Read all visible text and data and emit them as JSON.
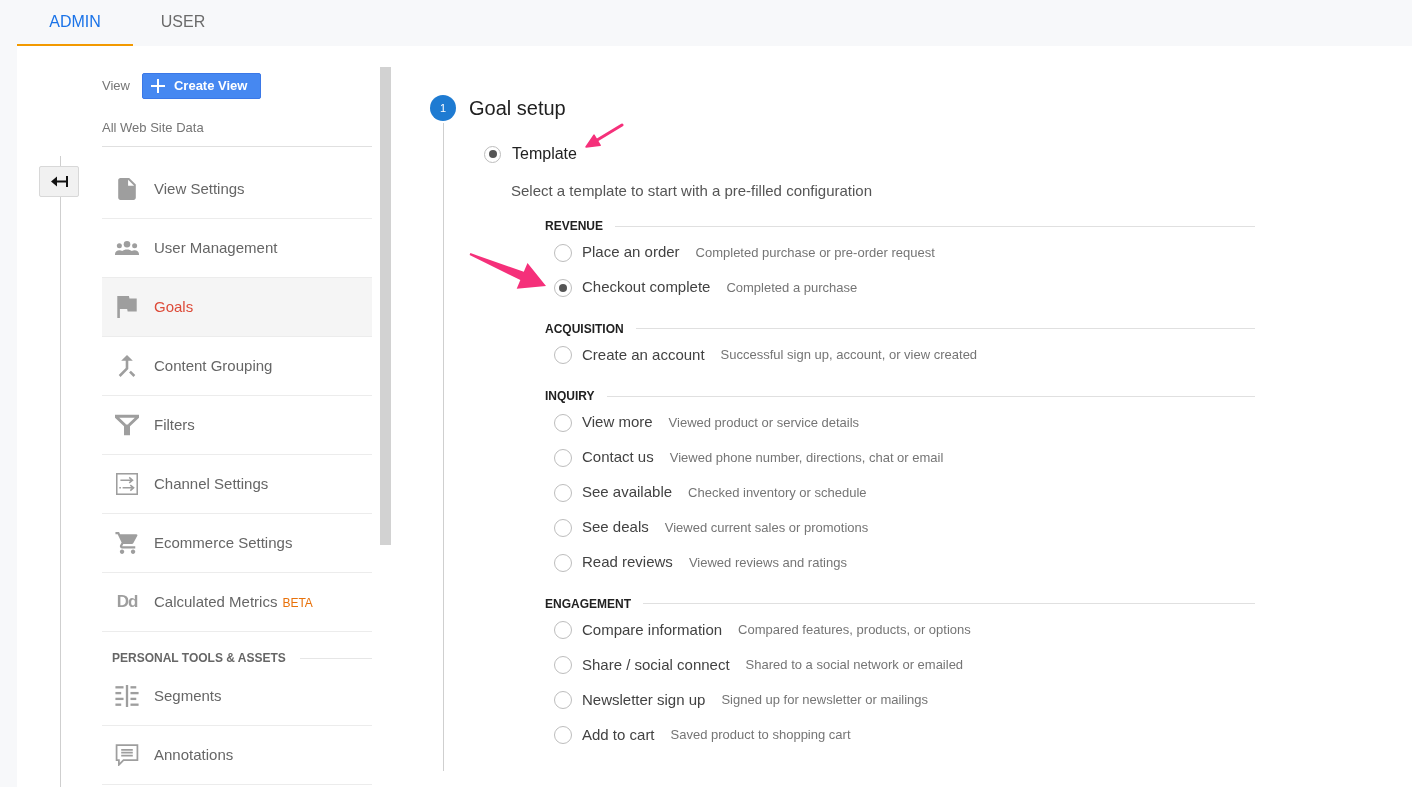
{
  "tabs": [
    {
      "label": "ADMIN",
      "selected": true
    },
    {
      "label": "USER",
      "selected": false
    }
  ],
  "sidebar": {
    "view_label": "View",
    "create_button": "Create View",
    "view_name": "All Web Site Data",
    "items": [
      {
        "label": "View Settings",
        "selected": false
      },
      {
        "label": "User Management",
        "selected": false
      },
      {
        "label": "Goals",
        "selected": true
      },
      {
        "label": "Content Grouping",
        "selected": false
      },
      {
        "label": "Filters",
        "selected": false
      },
      {
        "label": "Channel Settings",
        "selected": false
      },
      {
        "label": "Ecommerce Settings",
        "selected": false
      },
      {
        "label": "Calculated Metrics",
        "selected": false,
        "icon_text": "Dd",
        "badge": "BETA"
      }
    ],
    "personal_section": {
      "title": "PERSONAL TOOLS & ASSETS",
      "items": [
        {
          "label": "Segments",
          "selected": false
        },
        {
          "label": "Annotations",
          "selected": false
        }
      ]
    }
  },
  "goal_setup": {
    "step": "1",
    "title": "Goal setup",
    "goal_type": {
      "label": "Template",
      "selected": true
    },
    "description": "Select a template to start with a pre-filled configuration",
    "groups": [
      {
        "title": "REVENUE",
        "options": [
          {
            "label": "Place an order",
            "description": "Completed purchase or pre-order request",
            "selected": false
          },
          {
            "label": "Checkout complete",
            "description": "Completed a purchase",
            "selected": true
          }
        ]
      },
      {
        "title": "ACQUISITION",
        "options": [
          {
            "label": "Create an account",
            "description": "Successful sign up, account, or view created",
            "selected": false
          }
        ]
      },
      {
        "title": "INQUIRY",
        "options": [
          {
            "label": "View more",
            "description": "Viewed product or service details",
            "selected": false
          },
          {
            "label": "Contact us",
            "description": "Viewed phone number, directions, chat or email",
            "selected": false
          },
          {
            "label": "See available",
            "description": "Checked inventory or schedule",
            "selected": false
          },
          {
            "label": "See deals",
            "description": "Viewed current sales or promotions",
            "selected": false
          },
          {
            "label": "Read reviews",
            "description": "Viewed reviews and ratings",
            "selected": false
          }
        ]
      },
      {
        "title": "ENGAGEMENT",
        "options": [
          {
            "label": "Compare information",
            "description": "Compared features, products, or options",
            "selected": false
          },
          {
            "label": "Share / social connect",
            "description": "Shared to a social network or emailed",
            "selected": false
          },
          {
            "label": "Newsletter sign up",
            "description": "Signed up for newsletter or mailings",
            "selected": false
          },
          {
            "label": "Add to cart",
            "description": "Saved product to shopping cart",
            "selected": false
          }
        ]
      }
    ]
  }
}
